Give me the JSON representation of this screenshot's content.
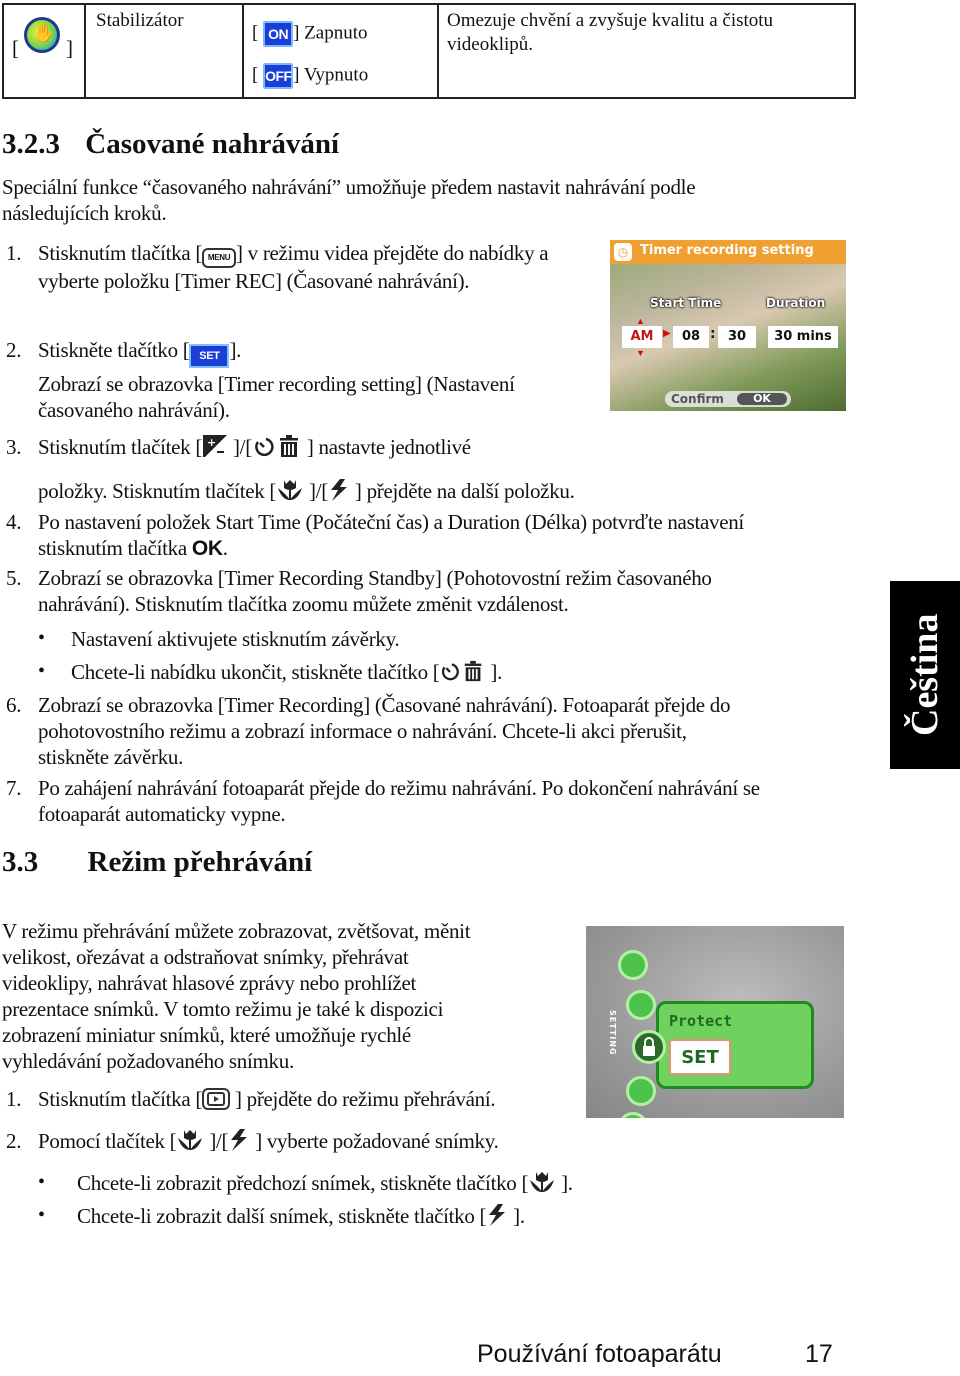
{
  "table": {
    "row": {
      "icon": "stabilizer-hand-icon",
      "bracket_open": "[",
      "bracket_close": "]",
      "name": "Stabilizátor",
      "options": [
        {
          "badge": "ON",
          "label": "Zapnuto"
        },
        {
          "badge": "OFF",
          "label": "Vypnuto"
        }
      ],
      "description": "Omezuje chvění a zvyšuje kvalitu a čistotu videoklipů."
    }
  },
  "section1": {
    "number": "3.2.3",
    "title": "Časované nahrávání",
    "intro": "Speciální funkce “časovaného nahrávání” umožňuje předem nastavit nahrávání podle následujících kroků.",
    "steps": [
      {
        "num": "1.",
        "pre": "Stisknutím tlačítka [",
        "icon": "menu-button-icon",
        "icon_text": "MENU",
        "post": "] v režimu videa přejděte do nabídky a vyberte položku [Timer REC] (Časované nahrávání)."
      },
      {
        "num": "2.",
        "pre": "Stiskněte tlačítko [",
        "icon": "set-button-icon",
        "icon_text": "SET",
        "post": "].",
        "extra": "Zobrazí se obrazovka [Timer recording setting] (Nastavení časovaného nahrávání)."
      },
      {
        "num": "3.",
        "pre": "Stisknutím tlačítek [",
        "mid1": " ]/[",
        "post1": " ] nastavte jednotlivé",
        "line2_pre": "položky. Stisknutím tlačítek [",
        "line2_mid": " ]/[",
        "line2_post": " ] přejděte na další položku."
      },
      {
        "num": "4.",
        "text": "Po nastavení položek Start Time (Počáteční čas) a Duration (Délka) potvrďte nastavení",
        "line2": "stisknutím tlačítka ",
        "bold": "OK",
        "end": "."
      },
      {
        "num": "5.",
        "text": "Zobrazí se obrazovka [Timer Recording Standby] (Pohotovostní režim časovaného",
        "line2": "nahrávání). Stisknutím tlačítka zoomu můžete změnit vzdálenost."
      },
      {
        "num": "6.",
        "text": "Zobrazí se obrazovka [Timer Recording] (Časované nahrávání). Fotoaparát přejde do",
        "line2": "pohotovostního režimu a zobrazí informace o nahrávání. Chcete-li akci přerušit,",
        "line3": "stiskněte závěrku."
      },
      {
        "num": "7.",
        "text": "Po zahájení nahrávání fotoaparát přejde do režimu nahrávání. Po dokončení nahrávání se",
        "line2": "fotoaparát automaticky vypne."
      }
    ],
    "bullets": [
      {
        "text": "Nastavení aktivujete stisknutím závěrky."
      },
      {
        "pre": "Chcete-li nabídku ukončit, stiskněte tlačítko [",
        "post": " ]."
      }
    ],
    "bullet_char": "•",
    "screen": {
      "title": "Timer recording setting",
      "start_time_label": "Start Time",
      "duration_label": "Duration",
      "ampm": "AM",
      "hour": "08",
      "separator": ":",
      "minute": "30",
      "duration": "30 mins",
      "confirm_label": "Confirm",
      "ok_label": "OK"
    }
  },
  "section2": {
    "number": "3.3",
    "title": "Režim přehrávání",
    "intro_lines": [
      "V režimu přehrávání můžete zobrazovat, zvětšovat, měnit",
      "velikost, ořezávat a odstraňovat snímky, přehrávat",
      "videoklipy, nahrávat hlasové zprávy nebo prohlížet",
      "prezentace snímků. V tomto režimu je také k dispozici",
      "zobrazení miniatur snímků, které umožňuje rychlé",
      "vyhledávání požadovaného snímku."
    ],
    "steps": [
      {
        "num": "1.",
        "pre": "Stisknutím tlačítka [",
        "post": " ] přejděte do režimu přehrávání."
      },
      {
        "num": "2.",
        "pre": "Pomocí tlačítek [",
        "mid": " ]/[",
        "post": " ] vyberte požadované snímky."
      }
    ],
    "bullets": [
      {
        "pre": "Chcete-li zobrazit předchozí snímek, stiskněte tlačítko [",
        "post": " ]."
      },
      {
        "pre": "Chcete-li zobrazit další snímek, stiskněte tlačítko [",
        "post": " ]."
      }
    ],
    "screen": {
      "menu_label": "Protect",
      "button_label": "SET",
      "side_label": "SETTING"
    }
  },
  "side_tab": {
    "label": "Čeština"
  },
  "footer": {
    "chapter": "Používání fotoaparátu",
    "page": "17"
  }
}
